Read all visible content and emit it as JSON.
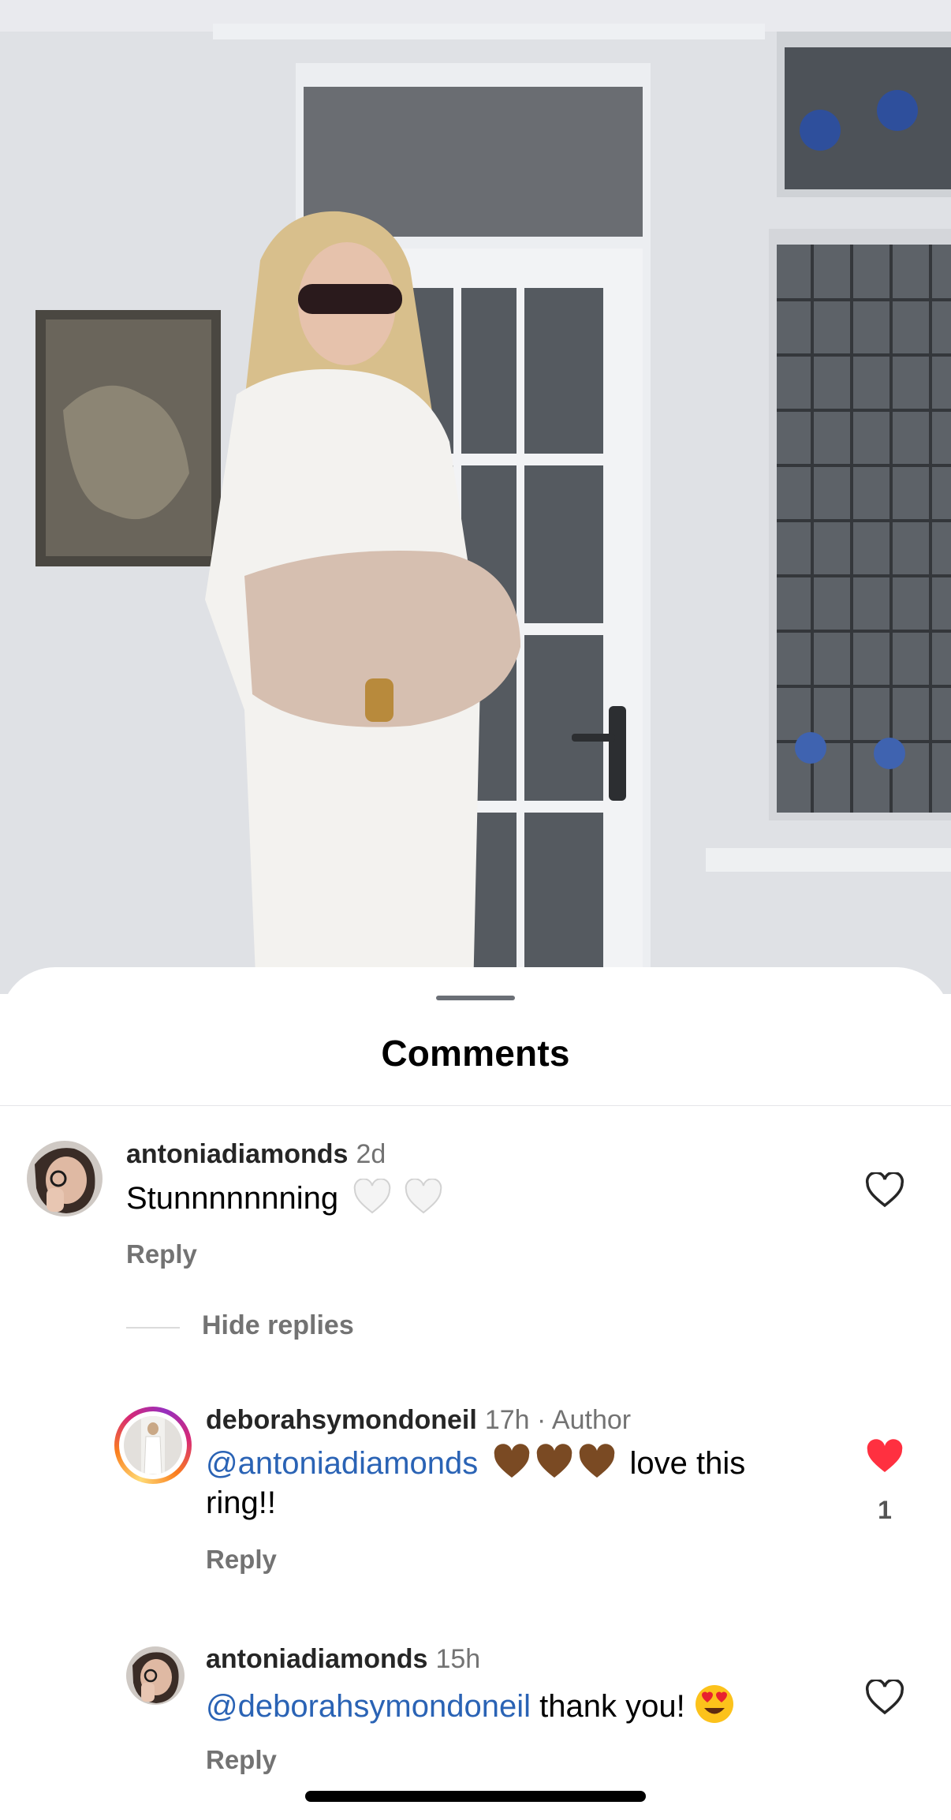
{
  "sheet": {
    "title": "Comments"
  },
  "comments": [
    {
      "username": "antoniadiamonds",
      "time": "2d",
      "text": "Stunnnnnnning",
      "emoji": "🤍🤍",
      "reply_label": "Reply",
      "liked": false
    }
  ],
  "thread": {
    "toggle_label": "Hide replies"
  },
  "replies": [
    {
      "username": "deborahsymondoneil",
      "time": "17h",
      "separator": "·",
      "badge": "Author",
      "mention": "@antoniadiamonds",
      "emoji": "🤎🤎🤎",
      "text": "love this ring!!",
      "reply_label": "Reply",
      "liked": true,
      "like_count": "1"
    },
    {
      "username": "antoniadiamonds",
      "time": "15h",
      "mention": "@deborahsymondoneil",
      "text": "thank you!",
      "emoji": "😍",
      "reply_label": "Reply",
      "liked": false
    }
  ],
  "colors": {
    "mention": "#2a63b5",
    "liked_heart": "#ff3040",
    "meta": "#737373"
  },
  "icons": [
    "heart-outline-icon",
    "heart-filled-icon",
    "white-heart-emoji",
    "brown-heart-emoji",
    "heart-eyes-emoji"
  ]
}
